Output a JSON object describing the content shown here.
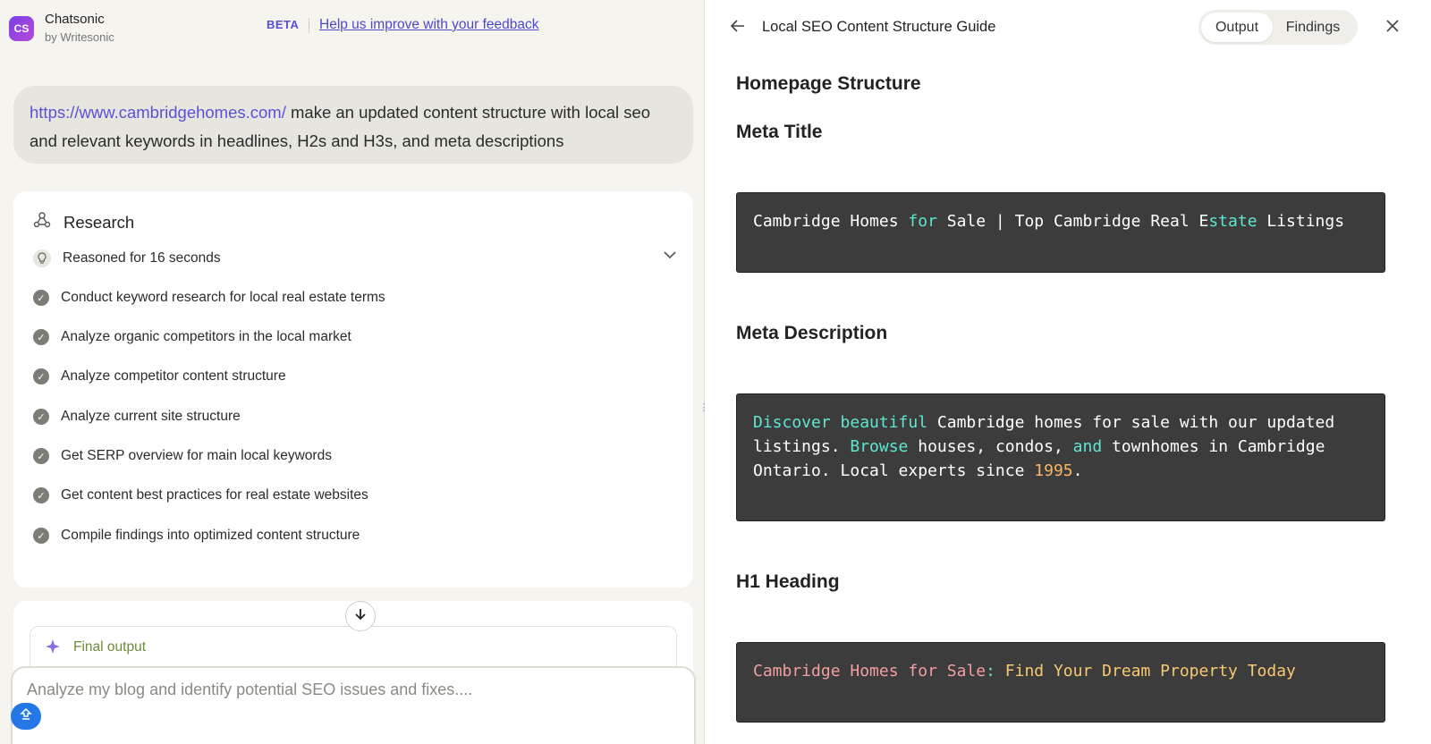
{
  "brand": {
    "logo": "CS",
    "name": "Chatsonic",
    "sub": "by Writesonic"
  },
  "header": {
    "beta": "BETA",
    "feedback": "Help us improve with your feedback"
  },
  "prompt": {
    "link": "https://www.cambridgehomes.com/",
    "text": " make an updated content structure with local seo and relevant keywords in headlines, H2s and H3s, and meta descriptions"
  },
  "research": {
    "title": "Research",
    "reasoned": "Reasoned for 16 seconds",
    "steps": [
      "Conduct keyword research for local real estate terms",
      "Analyze organic competitors in the local market",
      "Analyze competitor content structure",
      "Analyze current site structure",
      "Get SERP overview for main local keywords",
      "Get content best practices for real estate websites",
      "Compile findings into optimized content structure"
    ]
  },
  "final_output": {
    "label": "Final output"
  },
  "composer": {
    "placeholder": "Analyze my blog and identify potential SEO issues and fixes...."
  },
  "panel": {
    "title": "Local SEO Content Structure Guide",
    "tabs": [
      "Output",
      "Findings"
    ],
    "active_tab": "Output"
  },
  "document": {
    "section_title": "Homepage Structure",
    "meta_title_heading": "Meta Title",
    "meta_title": {
      "p1": "Cambridge Homes ",
      "k1": "for",
      "p2": " Sale | Top Cambridge Real E",
      "k2": "state",
      "p3": " Listings"
    },
    "meta_desc_heading": "Meta Description",
    "meta_desc": {
      "k1": "Discover beautiful",
      "p1": " Cambridge homes for sale with our updated listings. ",
      "k2": "Browse",
      "p2": " houses, condos, ",
      "k3": "and",
      "p3": " townhomes in Cambridge Ontario. Local experts since ",
      "n1": "1995",
      "p4": "."
    },
    "h1_heading": "H1 Heading",
    "h1": {
      "p1": "Cambridge Homes for Sale",
      "p2": ": ",
      "y1": "Find Your Dream Property Today"
    }
  },
  "colors": {
    "accent": "#5b50d6",
    "code_bg": "#3c3c3c",
    "keyword": "#5ee7d0",
    "number": "#f7b566"
  },
  "icons": [
    "back-arrow-icon",
    "close-icon",
    "research-icon",
    "lightbulb-icon",
    "check-icon",
    "chevron-down-icon",
    "sparkle-icon",
    "arrow-down-icon",
    "upload-icon",
    "drag-handle-icon"
  ]
}
